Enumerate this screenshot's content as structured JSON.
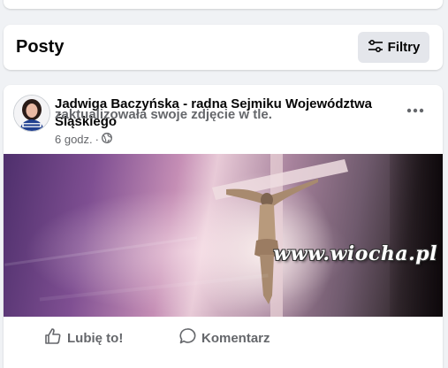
{
  "posts_header": {
    "title": "Posty",
    "filter_label": "Filtry",
    "filter_icon": "filter-sliders-icon"
  },
  "post": {
    "author_name": "Jadwiga Baczyńska - radna Sejmiku Województwa Śląskiego",
    "action_text": "zaktualizowała swoje zdjęcie w tle.",
    "timestamp": "6 godz.",
    "separator": "·",
    "privacy_icon": "globe-icon",
    "more_icon": "more-dots-icon",
    "cover_description_icon": "crucifix-image"
  },
  "actions": {
    "like_label": "Lubię to!",
    "comment_label": "Komentarz"
  },
  "watermark": "www.wiocha.pl",
  "colors": {
    "background": "#f0f2f5",
    "card": "#ffffff",
    "secondary_text": "#65676b",
    "button_bg": "#e4e6eb"
  }
}
